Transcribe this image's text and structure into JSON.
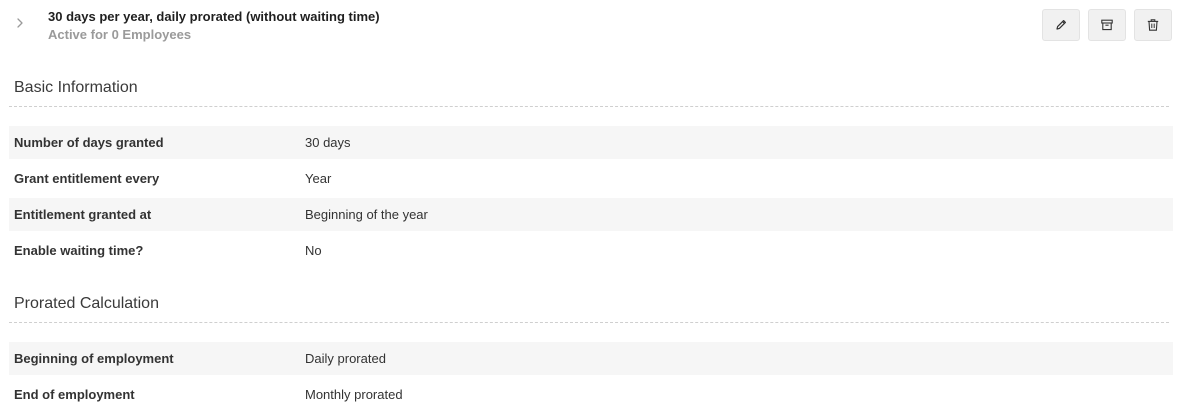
{
  "header": {
    "title": "30 days per year, daily prorated (without waiting time)",
    "subtitle": "Active for 0 Employees",
    "actions": [
      {
        "icon": "pencil-icon"
      },
      {
        "icon": "archive-icon"
      },
      {
        "icon": "trash-icon"
      }
    ]
  },
  "sections": [
    {
      "title": "Basic Information",
      "rows": [
        {
          "label": "Number of days granted",
          "value": "30 days"
        },
        {
          "label": "Grant entitlement every",
          "value": "Year"
        },
        {
          "label": "Entitlement granted at",
          "value": "Beginning of the year"
        },
        {
          "label": "Enable waiting time?",
          "value": "No"
        }
      ]
    },
    {
      "title": "Prorated Calculation",
      "rows": [
        {
          "label": "Beginning of employment",
          "value": "Daily prorated"
        },
        {
          "label": "End of employment",
          "value": "Monthly prorated"
        }
      ]
    }
  ]
}
